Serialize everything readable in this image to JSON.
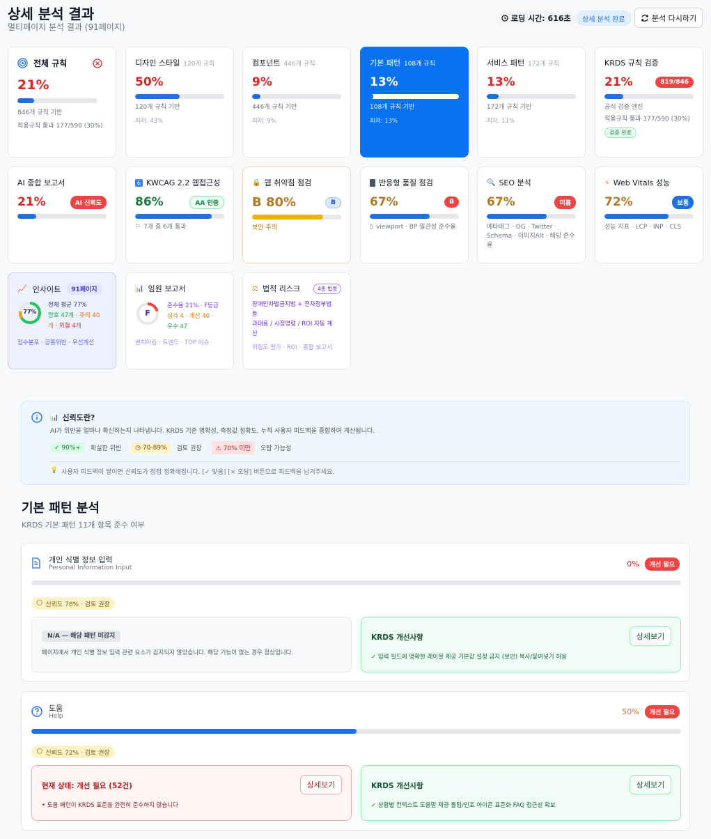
{
  "header": {
    "title": "상세 분석 결과",
    "subtitle": "멀티페이지 분석 결과 (91페이지)",
    "loading": "로딩 시간: 616초",
    "status": "상세 분석 완료",
    "reanalyze": "분석 다시하기"
  },
  "cards": {
    "c1": {
      "title": "전체 규칙",
      "pct": "21%",
      "progress": 0.21,
      "sub": "846개 규칙 기반",
      "meta": "적용규칙 통과 177/590 (30%)"
    },
    "c2": {
      "title": "디자인 스타일",
      "count": "120개 규칙",
      "pct": "50%",
      "progress": 0.5,
      "sub": "120개 규칙 기반",
      "meta": "최저: 43%"
    },
    "c3": {
      "title": "컴포넌트",
      "count": "446개 규칙",
      "pct": "9%",
      "progress": 0.09,
      "sub": "446개 규칙 기반",
      "meta": "최저: 9%"
    },
    "c4": {
      "title": "기본 패턴",
      "count": "108개 규칙",
      "pct": "13%",
      "progress": 0.13,
      "sub": "108개 규칙 기반",
      "meta": "최저: 13%"
    },
    "c5": {
      "title": "서비스 패턴",
      "count": "172개 규칙",
      "pct": "13%",
      "progress": 0.13,
      "sub": "172개 규칙 기반",
      "meta": "최저: 11%"
    },
    "c6": {
      "title": "KRDS 규칙 검증",
      "pct": "21%",
      "badge": "819/846",
      "progress": 0.21,
      "sub": "공식 검증 엔진",
      "meta": "적용규칙 통과 177/590 (30%)",
      "chip": "검증 완료"
    },
    "c7": {
      "title": "AI 종합 보고서",
      "pct": "21%",
      "badge": "AI 신뢰도",
      "progress": 0.21
    },
    "c8": {
      "title": "KWCAG 2.2 웹접근성",
      "pct": "86%",
      "badge": "AA 인증",
      "progress": 0.86,
      "sub": "7개 중 6개 통과"
    },
    "c9": {
      "title": "웹 취약점 점검",
      "pct": "B 80%",
      "badge": "B",
      "progress": 0.8,
      "sub": "보안 주의"
    },
    "c10": {
      "title": "반응형 품질 점검",
      "pct": "67%",
      "badge": "B",
      "progress": 0.67,
      "sub": "viewport · BP 일관성 준수율"
    },
    "c11": {
      "title": "SEO 분석",
      "pct": "67%",
      "badge": "미흡",
      "progress": 0.67,
      "sub": "메타태그 · OG · Twitter · Schema · 이미지Alt · 헤딩 준수율"
    },
    "c12": {
      "title": "Web Vitals 성능",
      "pct": "72%",
      "badge": "보통",
      "progress": 0.72,
      "sub": "성능 지표 · LCP · INP · CLS"
    },
    "c13": {
      "title": "인사이트",
      "badge": "91페이지",
      "ring": "77%",
      "ring_value": 0.77,
      "l1": "전체 평균 77%",
      "l2a": "양호 47개",
      "l2b": " · 주의 40",
      "l3a": "개",
      "l3b": " · 위험 4개",
      "foot": "점수분포 · 공통위반 · 우선개선"
    },
    "c14": {
      "title": "임원 보고서",
      "grade": "F",
      "ring_value": 0.21,
      "l1": "준수율 21% · F등급",
      "l2": "심각 4 · 개선 40 ·",
      "l3": "우수 47",
      "foot": "벤치마킹 · 트렌드 · TOP 이슈"
    },
    "c15": {
      "title": "법적 리스크",
      "badge": "4종 법령",
      "l1": "장애인차별금지법 + 전자정부법",
      "l2": "등",
      "l3": "과태료 / 시정명령 / ROI 자동 계",
      "l4": "산",
      "foot": "위험도 평가 · ROI · 종합 보고서"
    }
  },
  "info": {
    "title": "신뢰도란?",
    "desc": "AI가 위반을 얼마나 확신하는지 나타냅니다. KRDS 기준 명확성, 측정값 정확도, 누적 사용자 피드백을 종합하여 계산됩니다.",
    "l1b": "90%+",
    "l1t": "확실한 위반",
    "l2b": "70-89%",
    "l2t": "검토 권장",
    "l3b": "70% 미만",
    "l3t": "오탐 가능성",
    "tip": "사용자 피드백이 쌓이면 신뢰도가 점점 정확해집니다. [✓ 맞음] [× 오탐] 버튼으로 피드백을 남겨주세요."
  },
  "section": {
    "title": "기본 패턴 분석",
    "subtitle": "KRDS 기본 패턴 11개 항목 준수 여부"
  },
  "patterns": {
    "p1": {
      "name": "개인 식별 정보 입력",
      "en": "Personal Information Input",
      "pct": "0%",
      "badge": "개선 필요",
      "progress": 0,
      "chip": "신뢰도 78% · 검토 권장",
      "na": "N/A — 해당 패턴 미감지",
      "na_desc": "페이지에서 개인 식별 정보 입력 관련 요소가 감지되지 않았습니다. 해당 기능이 없는 경우 정상입니다.",
      "krds": "KRDS 개선사항",
      "detail": "상세보기",
      "items": "입력 필드에 명확한 레이블 제공   기본값 설정 금지 (보안)   복사/붙여넣기 허용"
    },
    "p2": {
      "name": "도움",
      "en": "Help",
      "pct": "50%",
      "badge": "개선 필요",
      "progress": 0.5,
      "chip": "신뢰도 72% · 검토 권장",
      "status": "현재 상태: 개선 필요  (52건)",
      "status_item": "도움 패턴이 KRDS 표준을 완전히 준수하지 않습니다",
      "krds": "KRDS 개선사항",
      "detail": "상세보기",
      "items": "상황별 컨텍스트 도움말 제공   툴팁/인포 아이콘 표준화   FAQ 접근성 확보"
    }
  }
}
